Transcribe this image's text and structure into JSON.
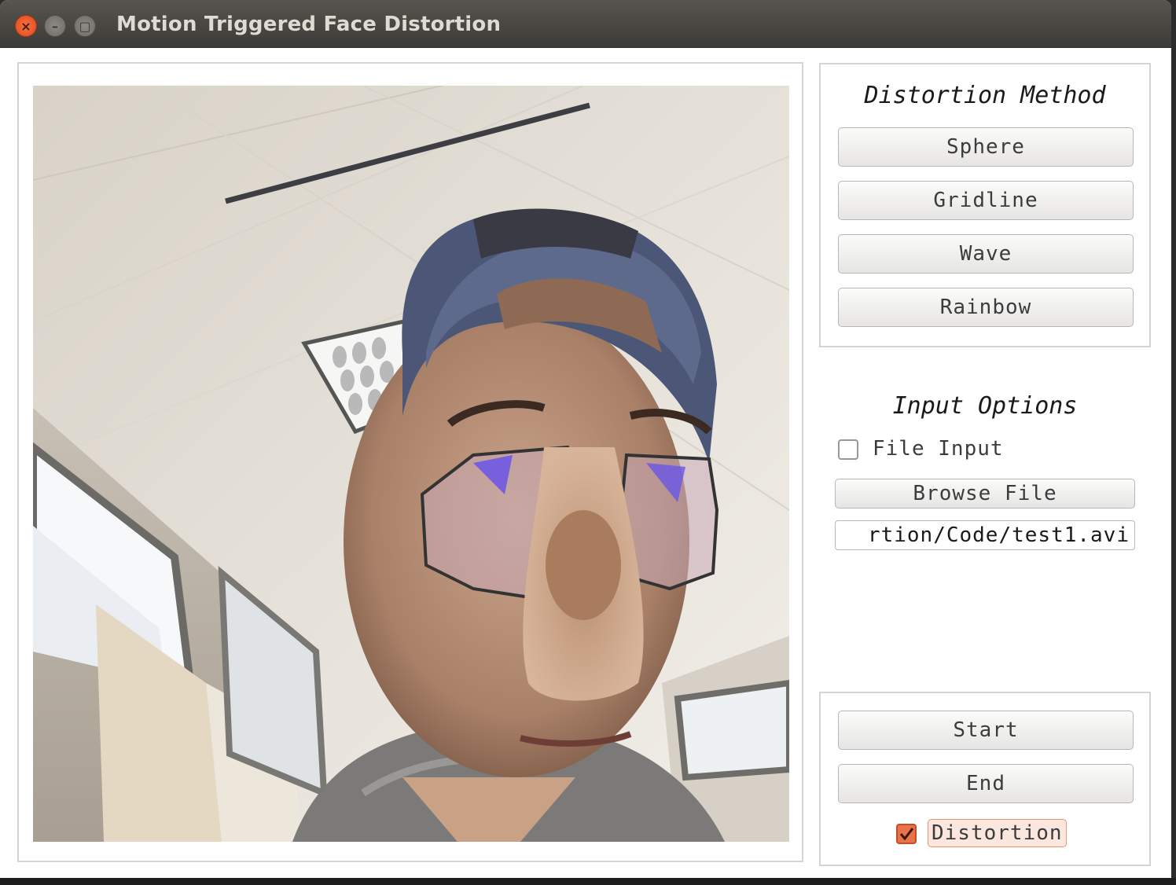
{
  "window": {
    "title": "Motion Triggered Face Distortion",
    "close_glyph": "×",
    "min_glyph": "–",
    "max_glyph": "▢"
  },
  "video": {
    "image_icon": "webcam-frame"
  },
  "distortion_method": {
    "heading": "Distortion Method",
    "buttons": [
      "Sphere",
      "Gridline",
      "Wave",
      "Rainbow"
    ]
  },
  "input_options": {
    "heading": "Input Options",
    "file_input_label": "File Input",
    "file_input_checked": false,
    "browse_label": "Browse File",
    "file_path": "rtion/Code/test1.avi"
  },
  "controls": {
    "start_label": "Start",
    "end_label": "End",
    "distortion_label": "Distortion",
    "distortion_checked": true
  },
  "colors": {
    "accent": "#e0643c",
    "titlebar": "#3c3b37"
  }
}
